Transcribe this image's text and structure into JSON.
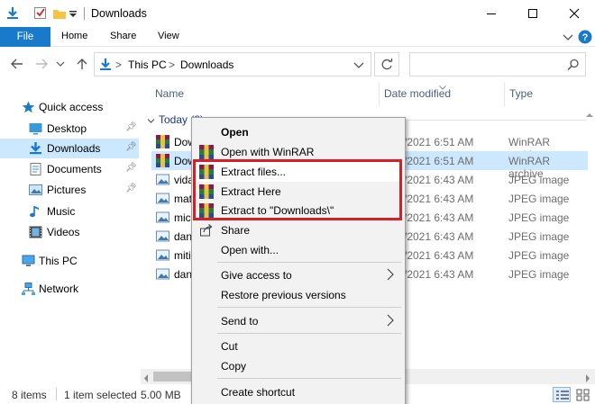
{
  "window": {
    "title": "Downloads"
  },
  "ribbon": {
    "file": "File",
    "tabs": [
      "Home",
      "Share",
      "View"
    ]
  },
  "address": {
    "root": "This PC",
    "folder": "Downloads",
    "separator": ">"
  },
  "columns": {
    "name": "Name",
    "date": "Date modified",
    "type": "Type"
  },
  "navpane": {
    "items": [
      {
        "label": "Quick access",
        "icon": "star-icon"
      },
      {
        "label": "Desktop",
        "icon": "desktop-icon",
        "pinned": true
      },
      {
        "label": "Downloads",
        "icon": "download-icon",
        "pinned": true,
        "selected": true
      },
      {
        "label": "Documents",
        "icon": "documents-icon",
        "pinned": true
      },
      {
        "label": "Pictures",
        "icon": "pictures-icon",
        "pinned": true
      },
      {
        "label": "Music",
        "icon": "music-icon"
      },
      {
        "label": "Videos",
        "icon": "videos-icon"
      },
      {
        "label": "This PC",
        "icon": "this-pc-icon"
      },
      {
        "label": "Network",
        "icon": "network-icon"
      }
    ]
  },
  "group": {
    "label": "Today (8)"
  },
  "files": [
    {
      "name": "Dow",
      "date": "/2021 6:51 AM",
      "type": "WinRAR archive",
      "icon": "winrar-icon"
    },
    {
      "name": "Dow",
      "date": "/2021 6:51 AM",
      "type": "WinRAR archive",
      "icon": "winrar-icon",
      "selected": true
    },
    {
      "name": "vida",
      "date": "/2021 6:43 AM",
      "type": "JPEG image",
      "icon": "image-icon"
    },
    {
      "name": "mat",
      "date": "/2021 6:43 AM",
      "type": "JPEG image",
      "icon": "image-icon"
    },
    {
      "name": "mic",
      "date": "/2021 6:43 AM",
      "type": "JPEG image",
      "icon": "image-icon"
    },
    {
      "name": "dan",
      "date": "/2021 6:43 AM",
      "type": "JPEG image",
      "icon": "image-icon"
    },
    {
      "name": "miti",
      "date": "/2021 6:43 AM",
      "type": "JPEG image",
      "icon": "image-icon"
    },
    {
      "name": "dan",
      "date": "/2021 6:43 AM",
      "type": "JPEG image",
      "icon": "image-icon"
    }
  ],
  "context_menu": {
    "open": "Open",
    "open_winrar": "Open with WinRAR",
    "extract_files": "Extract files...",
    "extract_here": "Extract Here",
    "extract_to": "Extract to \"Downloads\\\"",
    "share": "Share",
    "open_with": "Open with...",
    "give_access": "Give access to",
    "restore": "Restore previous versions",
    "send_to": "Send to",
    "cut": "Cut",
    "copy": "Copy",
    "create_shortcut": "Create shortcut"
  },
  "status": {
    "items": "8 items",
    "selected": "1 item selected",
    "size": "5.00 MB"
  },
  "colors": {
    "accent": "#1979ca",
    "selection": "#cce8ff",
    "highlight_box": "#d42027",
    "group_text": "#1e3287"
  }
}
